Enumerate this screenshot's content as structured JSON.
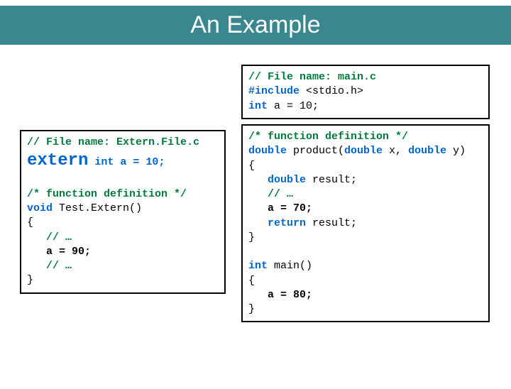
{
  "title": "An Example",
  "left": {
    "l1": "// File name: Extern.File.c",
    "l2a": "extern",
    "l2b": " int a = 10;",
    "l3": " ",
    "l4a": "/* function definition */",
    "l5a": "void",
    "l5b": " Test.Extern()",
    "l6": "{",
    "l7": "   // …",
    "l8a": "   a = ",
    "l8b": "90;",
    "l9": "   // …",
    "l10": "}"
  },
  "rightTop": {
    "l1": "// File name: main.c",
    "l2a": "#include",
    "l2b": " <stdio.h>",
    "l3a": "int",
    "l3b": " a = 10;"
  },
  "rightMain": {
    "l1a": "/* function definition */",
    "l2a": "double",
    "l2b": " product(",
    "l2c": "double",
    "l2d": " x, ",
    "l2e": "double",
    "l2f": " y)",
    "l3": "{",
    "l4a": "   double",
    "l4b": " result;",
    "l5": "   // …",
    "l6a": "   a = ",
    "l6b": "70;",
    "l7a": "   return",
    "l7b": " result;",
    "l8": "}",
    "l9": " ",
    "l10a": "int",
    "l10b": " main()",
    "l11": "{",
    "l12a": "   a = ",
    "l12b": "80;",
    "l13": "}"
  }
}
